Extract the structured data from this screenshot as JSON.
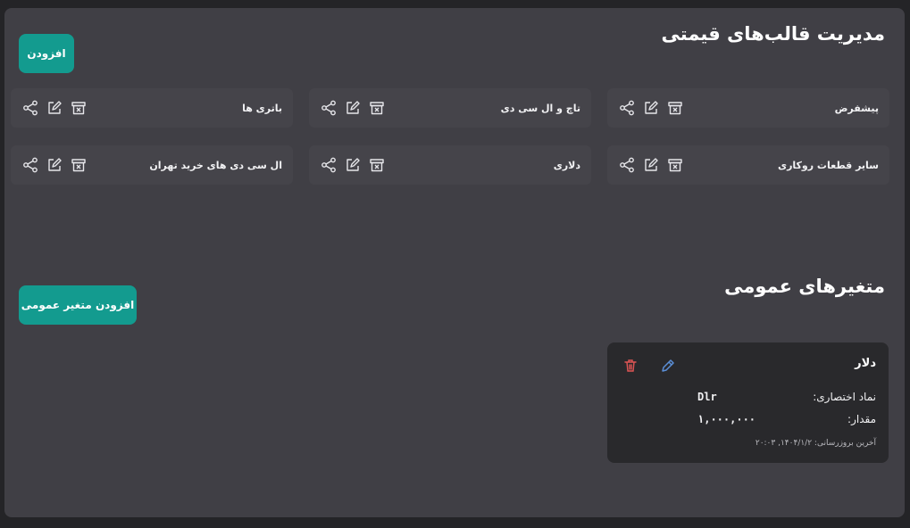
{
  "templates_section": {
    "title": "مدیریت قالب‌های قیمتی",
    "add_label": "افزودن",
    "items": [
      {
        "name": "پیشفرض"
      },
      {
        "name": "تاچ و ال سی دی"
      },
      {
        "name": "باتری ها"
      },
      {
        "name": "سایر قطعات روکاری"
      },
      {
        "name": "دلاری"
      },
      {
        "name": "ال سی دی های خرید تهران"
      }
    ]
  },
  "variables_section": {
    "title": "متغیرهای عمومی",
    "add_label": "افزودن متغیر عمومی",
    "items": [
      {
        "name": "دلار",
        "symbol_label": "نماد اختصاری:",
        "symbol": "Dlr",
        "value_label": "مقدار:",
        "value": "۱,۰۰۰,۰۰۰",
        "updated": "آخرین بروزرسانی: ۱۴۰۴/۱/۲, ۲۰:۰۳"
      }
    ]
  },
  "colors": {
    "accent": "#139b8f",
    "panel": "#403f45",
    "card": "#45444a",
    "delete": "#e05555",
    "edit": "#5b8fd8"
  },
  "icons": [
    "share-icon",
    "edit-icon",
    "archive-icon",
    "pencil-icon",
    "trash-icon"
  ]
}
